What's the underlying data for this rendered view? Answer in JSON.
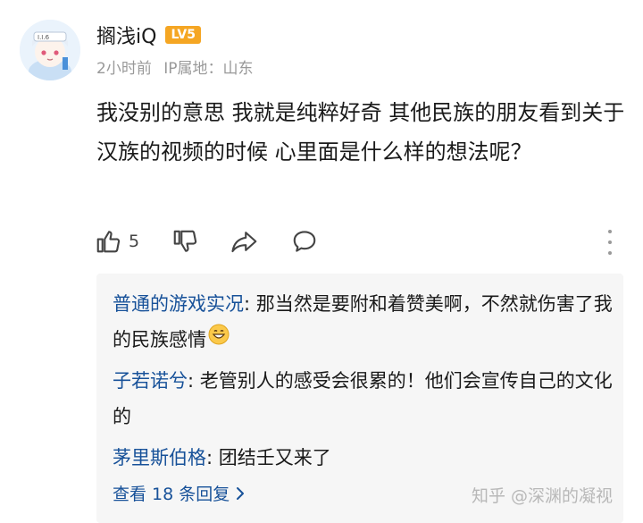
{
  "comment": {
    "username": "搁浅iQ",
    "level_badge": "LV5",
    "time_ago": "2小时前",
    "ip_location": "IP属地：山东",
    "text": "我没别的意思 我就是纯粹好奇 其他民族的朋友看到关于汉族的视频的时候 心里面是什么样的想法呢？",
    "like_count": "5"
  },
  "actions": {
    "like_icon": "thumbs-up-icon",
    "dislike_icon": "thumbs-down-icon",
    "share_icon": "share-icon",
    "reply_icon": "comment-bubble-icon",
    "more_icon": "more-vertical-icon"
  },
  "replies": [
    {
      "author": "普通的游戏实况",
      "separator": ": ",
      "text": "那当然是要附和着赞美啊，不然就伤害了我的民族感情",
      "emoji": "grinning-face-icon"
    },
    {
      "author": "子若诺兮",
      "separator": ": ",
      "text": "老管别人的感受会很累的！他们会宣传自己的文化的"
    },
    {
      "author": "茅里斯伯格",
      "separator": ": ",
      "text": "团结壬又来了"
    }
  ],
  "view_all_replies": "查看 18 条回复",
  "watermark": "知乎 @深渊的凝视",
  "colors": {
    "link": "#175199",
    "meta": "#999999",
    "badge": "#f5a623",
    "reply_bg": "#f6f6f6"
  }
}
